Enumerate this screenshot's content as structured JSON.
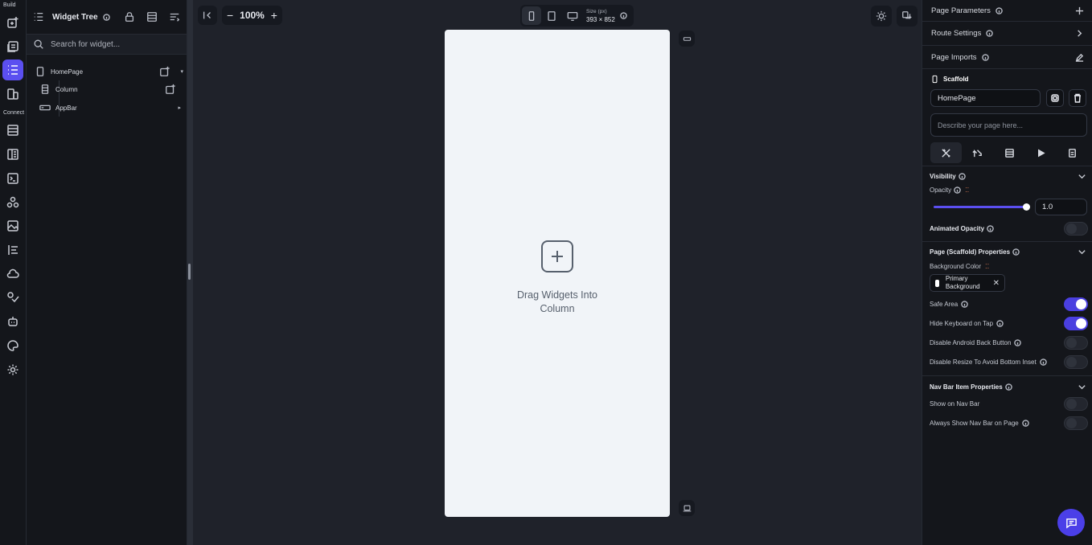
{
  "rail": {
    "build_label": "Build",
    "connect_label": "Connect"
  },
  "tree": {
    "title": "Widget Tree",
    "search_placeholder": "Search for widget...",
    "nodes": [
      {
        "label": "HomePage"
      },
      {
        "label": "Column"
      },
      {
        "label": "AppBar"
      }
    ]
  },
  "canvas": {
    "zoom": "100%",
    "size_label": "Size (px)",
    "size_value": "393 × 852",
    "drop_text": "Drag Widgets Into Column"
  },
  "props": {
    "page_parameters": "Page Parameters",
    "route_settings": "Route Settings",
    "page_imports": "Page Imports",
    "widget_type": "Scaffold",
    "page_name": "HomePage",
    "description_placeholder": "Describe your page here...",
    "visibility": "Visibility",
    "opacity_label": "Opacity",
    "opacity_value": "1.0",
    "opacity_level": 1.0,
    "animated_opacity": "Animated Opacity",
    "scaffold_section": "Page (Scaffold) Properties",
    "bg_color_label": "Background Color",
    "bg_color_value_line1": "Primary",
    "bg_color_value_line2": "Background",
    "safe_area": "Safe Area",
    "hide_keyboard": "Hide Keyboard on Tap",
    "disable_back": "Disable Android Back Button",
    "disable_resize": "Disable Resize To Avoid Bottom Inset",
    "nav_section": "Nav Bar Item Properties",
    "show_nav": "Show on Nav Bar",
    "always_show_nav": "Always Show Nav Bar on Page"
  },
  "colors": {
    "accent": "#5b4ff0",
    "canvas_bg": "#1f222a",
    "panel_bg": "#14161b",
    "phone_bg": "#f1f4f8"
  }
}
